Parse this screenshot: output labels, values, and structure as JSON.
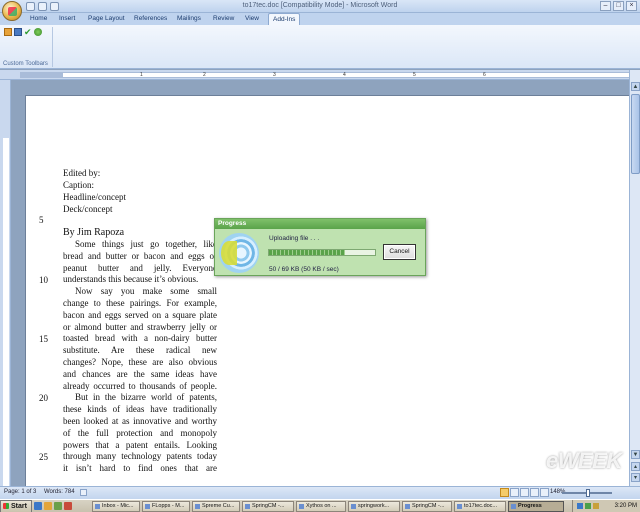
{
  "window": {
    "title": "to17tec.doc [Compatibility Mode] - Microsoft Word",
    "controls": [
      "–",
      "□",
      "×"
    ]
  },
  "ribbon": {
    "tabs": [
      "Home",
      "Insert",
      "Page Layout",
      "References",
      "Mailings",
      "Review",
      "View",
      "Add-Ins"
    ],
    "active_tab": "Add-Ins",
    "group_label": "Custom Toolbars",
    "icons": [
      "addin-star-icon",
      "addin-save-icon",
      "addin-check-icon",
      "addin-globe-icon"
    ]
  },
  "ruler": {
    "numbers": [
      "1",
      "2",
      "3",
      "4",
      "5",
      "6"
    ]
  },
  "document": {
    "header_lines": [
      "Edited by:",
      "Caption:",
      "Headline/concept",
      "Deck/concept"
    ],
    "byline": "By Jim Rapoza",
    "body_lines": [
      "Some things just go together, like",
      "bread and butter or bacon and eggs or",
      "peanut butter and jelly. Everyone",
      "understands this because it’s obvious.",
      "Now say you make some small",
      "change to these pairings. For example,",
      "bacon and eggs served on a square plate",
      "or almond butter and strawberry jelly or",
      "toasted bread with a non-dairy butter",
      "substitute. Are these radical new",
      "changes? Nope, these are also obvious",
      "and chances are the same ideas have",
      "already occurred to thousands of people.",
      "But in the bizarre world of patents,",
      "these kinds of ideas have traditionally",
      "been looked at as innovative and worthy",
      "of the full protection and monopoly",
      "powers that a patent entails. Looking",
      "through many technology patents today",
      "it isn’t hard to find ones that are"
    ],
    "line_numbers": [
      "5",
      "10",
      "15",
      "20",
      "25"
    ]
  },
  "dialog": {
    "title": "Progress",
    "message": "Uploading file . . .",
    "stats": "50 / 69 KB  (50 KB / sec)",
    "progress": 0.72,
    "cancel_label": "Cancel"
  },
  "status": {
    "page": "Page: 1 of 3",
    "words": "Words: 784",
    "zoom": "148%"
  },
  "taskbar": {
    "start_label": "Start",
    "tasks": [
      "Inbox - Mic...",
      "FLopps - M...",
      "Spreme Cu...",
      "SpringCM -...",
      "Xythos on ...",
      "springwork...",
      "SpringCM -...",
      "to17tec.doc...",
      "Progress"
    ],
    "active_task": "Progress",
    "clock": "3:20 PM"
  },
  "watermark": "eWEEK"
}
